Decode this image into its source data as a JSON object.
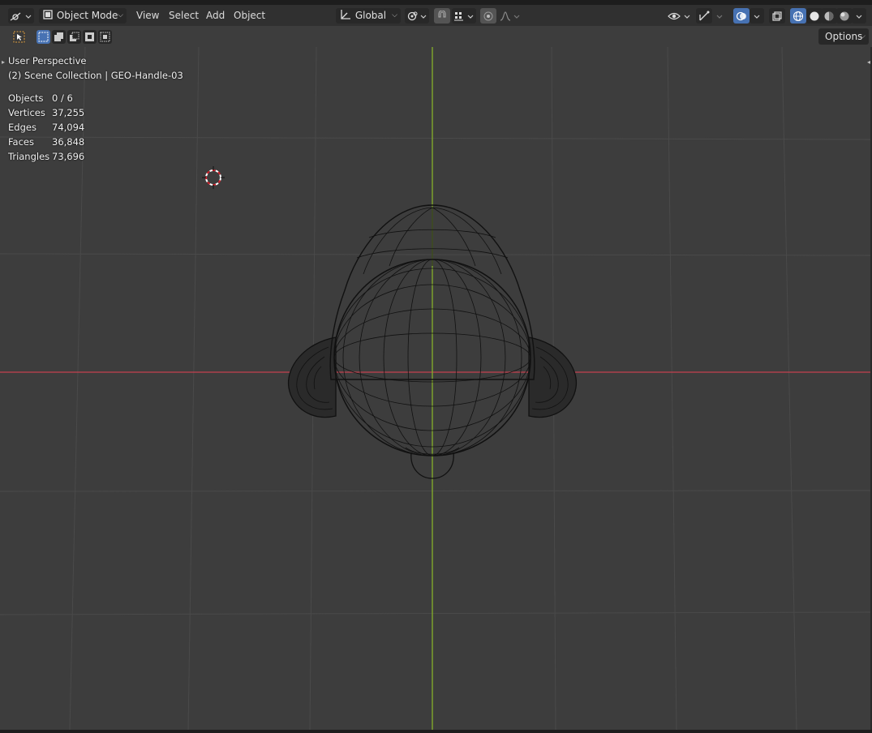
{
  "header": {
    "mode_label": "Object Mode",
    "menus": [
      "View",
      "Select",
      "Add",
      "Object"
    ],
    "transform_orientation": "Global",
    "options_label": "Options"
  },
  "overlay": {
    "perspective": "User Perspective",
    "collection": "(2) Scene Collection | GEO-Handle-03",
    "stats": [
      {
        "label": "Objects",
        "value": "0 / 6"
      },
      {
        "label": "Vertices",
        "value": "37,255"
      },
      {
        "label": "Edges",
        "value": "74,094"
      },
      {
        "label": "Faces",
        "value": "36,848"
      },
      {
        "label": "Triangles",
        "value": "73,696"
      }
    ]
  },
  "colors": {
    "viewport_bg": "#3d3d3d",
    "header_bg": "#303030",
    "accent_blue": "#4772b3",
    "x_axis": "#c4414f",
    "y_axis": "#86b02a",
    "grid": "#4a4a4a",
    "wire": "#111111"
  },
  "icons": [
    "editor-type-icon",
    "object-mode-icon",
    "transform-orientation-icon",
    "pivot-icon",
    "snap-icon",
    "snap-increment-icon",
    "proportional-edit-icon",
    "falloff-icon",
    "visibility-icon",
    "gizmo-icon",
    "overlay-icon",
    "xray-icon",
    "shading-wireframe-icon",
    "shading-solid-icon",
    "shading-material-icon",
    "shading-rendered-icon",
    "select-tool-icon",
    "select-new-icon",
    "select-extend-icon",
    "select-subtract-icon",
    "select-invert-icon",
    "select-intersect-icon",
    "cursor-icon"
  ]
}
